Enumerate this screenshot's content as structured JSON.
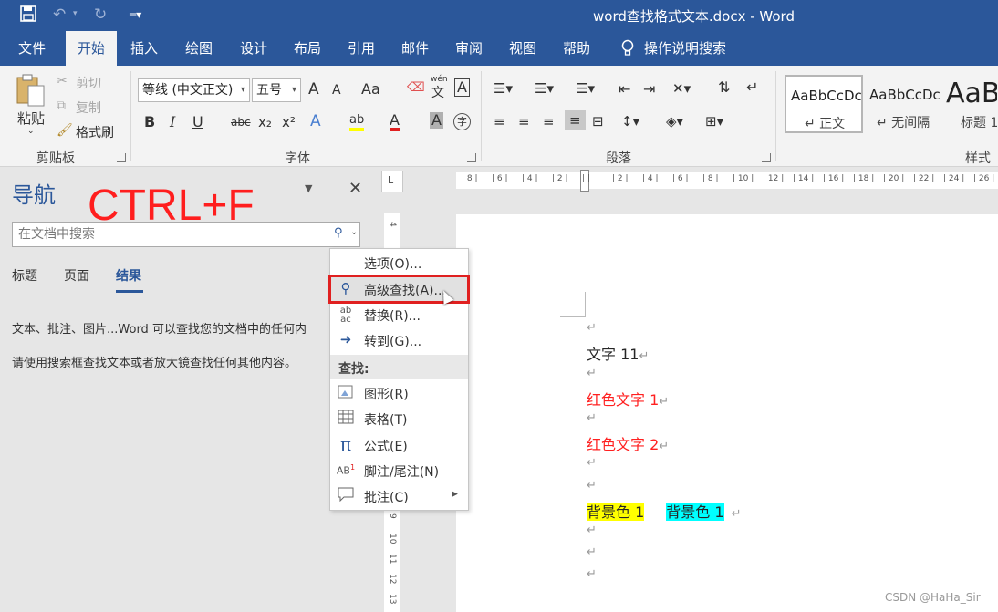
{
  "titlebar": {
    "title": "word查找格式文本.docx  -  Word",
    "save_icon": "save-icon",
    "undo_icon": "undo-icon",
    "redo_icon": "redo-icon",
    "customize_icon": "customize-icon"
  },
  "tabs": [
    "文件",
    "开始",
    "插入",
    "绘图",
    "设计",
    "布局",
    "引用",
    "邮件",
    "审阅",
    "视图",
    "帮助",
    "操作说明搜索"
  ],
  "ribbon": {
    "clipboard": {
      "paste": "粘贴",
      "cut": "剪切",
      "copy": "复制",
      "format_painter": "格式刷",
      "label": "剪贴板"
    },
    "font": {
      "font_name": "等线 (中文正文)",
      "font_size": "五号",
      "grow": "A",
      "shrink": "A",
      "case": "Aa",
      "pinyin": "wén",
      "pinyin_char": "文",
      "border_char": "A",
      "bold": "B",
      "italic": "I",
      "underline": "U",
      "strike": "abc",
      "subscript": "x₂",
      "superscript": "x²",
      "effects": "A",
      "highlight": "ab",
      "font_color": "A",
      "shading": "A",
      "enclose": "字",
      "label": "字体"
    },
    "paragraph": {
      "label": "段落"
    },
    "styles": {
      "items": [
        {
          "sample": "AaBbCcDc",
          "name": "↵ 正文"
        },
        {
          "sample": "AaBbCcDc",
          "name": "↵ 无间隔"
        },
        {
          "sample": "AaB",
          "name": "标题 1"
        }
      ],
      "label": "样式"
    }
  },
  "nav": {
    "title": "导航",
    "shortcut_annotation": "CTRL+F",
    "search_placeholder": "在文档中搜索",
    "tabs": [
      "标题",
      "页面",
      "结果"
    ],
    "text1": "文本、批注、图片...Word 可以查找您的文档中的任何内",
    "text2": "请使用搜索框查找文本或者放大镜查找任何其他内容。"
  },
  "menu": {
    "items_top": [
      {
        "label": "选项(O)...",
        "icon": ""
      },
      {
        "label": "高级查找(A)...",
        "icon": "search-icon"
      },
      {
        "label": "替换(R)...",
        "icon": "replace-icon"
      },
      {
        "label": "转到(G)...",
        "icon": "goto-arrow-icon"
      }
    ],
    "find_header": "查找:",
    "items_find": [
      {
        "label": "图形(R)",
        "icon": "graphics-icon"
      },
      {
        "label": "表格(T)",
        "icon": "table-icon"
      },
      {
        "label": "公式(E)",
        "icon": "pi-icon"
      },
      {
        "label": "脚注/尾注(N)",
        "icon": "footnote-icon"
      },
      {
        "label": "批注(C)",
        "icon": "comment-icon"
      }
    ]
  },
  "hruler_ticks": [
    "8",
    "6",
    "4",
    "2",
    "",
    "2",
    "4",
    "6",
    "8",
    "10",
    "12",
    "14",
    "16",
    "18",
    "20",
    "22",
    "24",
    "26"
  ],
  "vruler_ticks": [
    "4",
    "9",
    "10",
    "11",
    "12",
    "13"
  ],
  "document": {
    "para_mark": "↵",
    "line1": "文字 11",
    "line2": "红色文字 1",
    "line3": "红色文字 2",
    "bg1": "背景色 1",
    "bg2": "背景色 1"
  },
  "watermark": "CSDN @HaHa_Sir",
  "colors": {
    "word_blue": "#2b579a",
    "red_text": "#ff2020",
    "highlight_yellow": "#ffff00",
    "highlight_cyan": "#00ffff",
    "annotation_red": "#e02020"
  }
}
